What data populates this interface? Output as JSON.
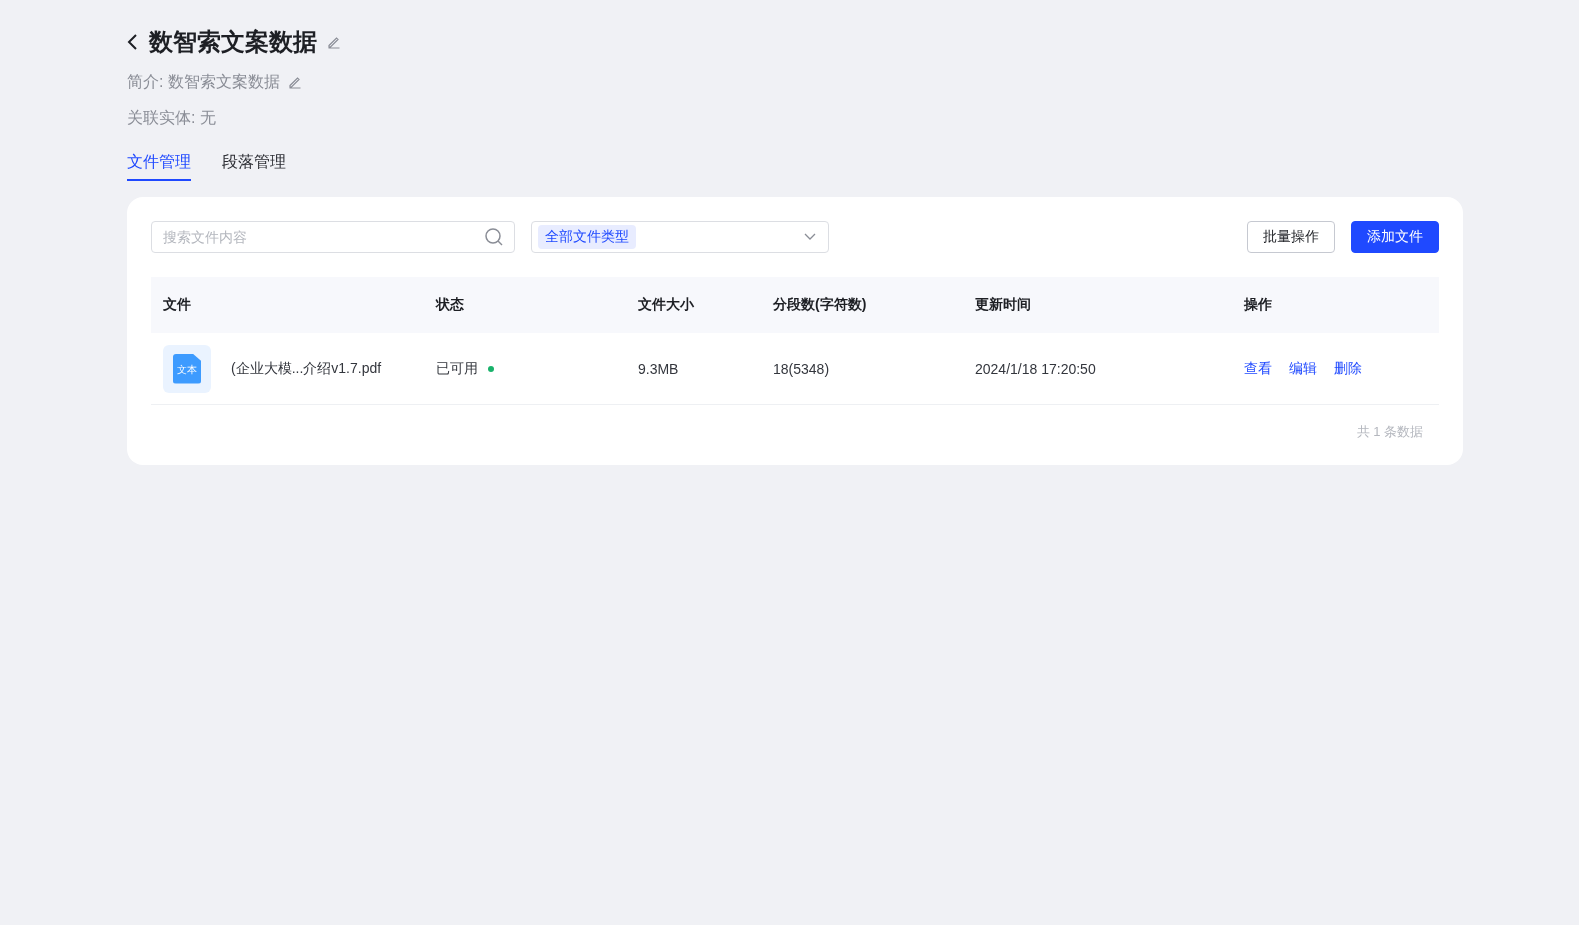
{
  "header": {
    "title": "数智索文案数据",
    "description": "简介: 数智索文案数据",
    "entity": "关联实体: 无"
  },
  "tabs": [
    {
      "label": "文件管理",
      "selected": true
    },
    {
      "label": "段落管理",
      "selected": false
    }
  ],
  "toolbar": {
    "search": {
      "placeholder": "搜索文件内容"
    },
    "filter": {
      "tag": "全部文件类型"
    },
    "buttons": [
      {
        "label": "批量操作",
        "kind": "secondary"
      },
      {
        "label": "添加文件",
        "kind": "primary"
      }
    ]
  },
  "table": {
    "columns": [
      "文件",
      "状态",
      "文件大小",
      "分段数(字符数)",
      "更新时间",
      "操作"
    ],
    "rows": [
      {
        "file_icon_label": "文本",
        "file": "(企业大模...介绍v1.7.pdf",
        "status": "已可用",
        "color": "#19b26b",
        "size": "9.3MB",
        "segments": "18(5348)",
        "updated": "2024/1/18 17:20:50",
        "actions": [
          "查看",
          "编辑",
          "删除"
        ]
      }
    ]
  },
  "footer": {
    "total": "共 1 条数据"
  }
}
